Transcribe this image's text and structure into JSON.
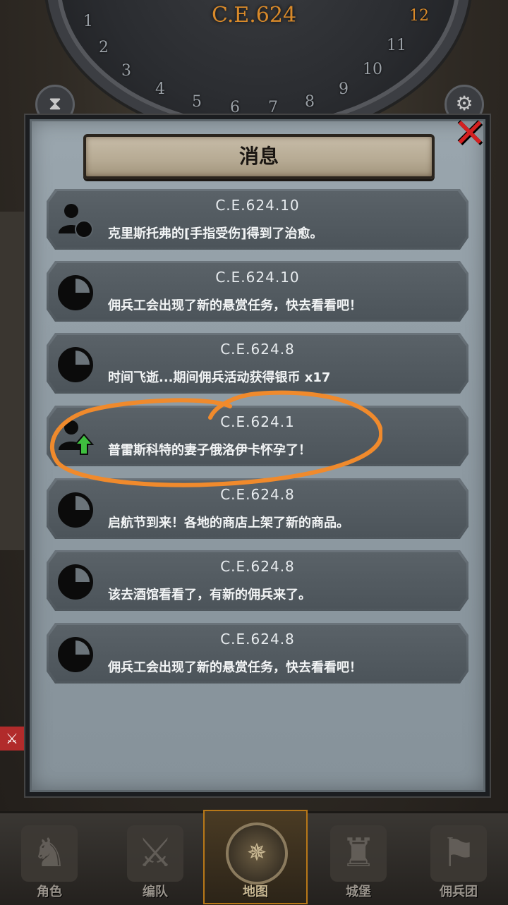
{
  "hud": {
    "date": "C.E.624",
    "dial_numbers": [
      "1",
      "2",
      "3",
      "4",
      "5",
      "6",
      "7",
      "8",
      "9",
      "10",
      "11",
      "12"
    ]
  },
  "dialog": {
    "title": "消息",
    "close_label": "✕",
    "messages": [
      {
        "date": "C.E.624.10",
        "text": "克里斯托弗的[手指受伤]得到了治愈。",
        "icon": "person-icon"
      },
      {
        "date": "C.E.624.10",
        "text": "佣兵工会出现了新的悬赏任务，快去看看吧！",
        "icon": "clock-icon"
      },
      {
        "date": "C.E.624.8",
        "text": "时间飞逝...期间佣兵活动获得银币 x17",
        "icon": "clock-icon"
      },
      {
        "date": "C.E.624.1",
        "text": "普雷斯科特的妻子俄洛伊卡怀孕了！",
        "icon": "person-up-icon"
      },
      {
        "date": "C.E.624.8",
        "text": "启航节到来！各地的商店上架了新的商品。",
        "icon": "clock-icon"
      },
      {
        "date": "C.E.624.8",
        "text": "该去酒馆看看了，有新的佣兵来了。",
        "icon": "clock-icon"
      },
      {
        "date": "C.E.624.8",
        "text": "佣兵工会出现了新的悬赏任务，快去看看吧！",
        "icon": "clock-icon"
      }
    ]
  },
  "nav": {
    "items": [
      {
        "label": "角色",
        "icon": "knight-icon"
      },
      {
        "label": "编队",
        "icon": "squad-icon"
      },
      {
        "label": "地图",
        "icon": "compass-icon",
        "active": true
      },
      {
        "label": "城堡",
        "icon": "castle-icon"
      },
      {
        "label": "佣兵团",
        "icon": "banner-icon"
      }
    ],
    "compass_north": "N"
  },
  "colors": {
    "accent": "#d98a2a",
    "annotation": "#f08a2c",
    "close": "#d42020",
    "up_arrow": "#3fbf3f"
  }
}
